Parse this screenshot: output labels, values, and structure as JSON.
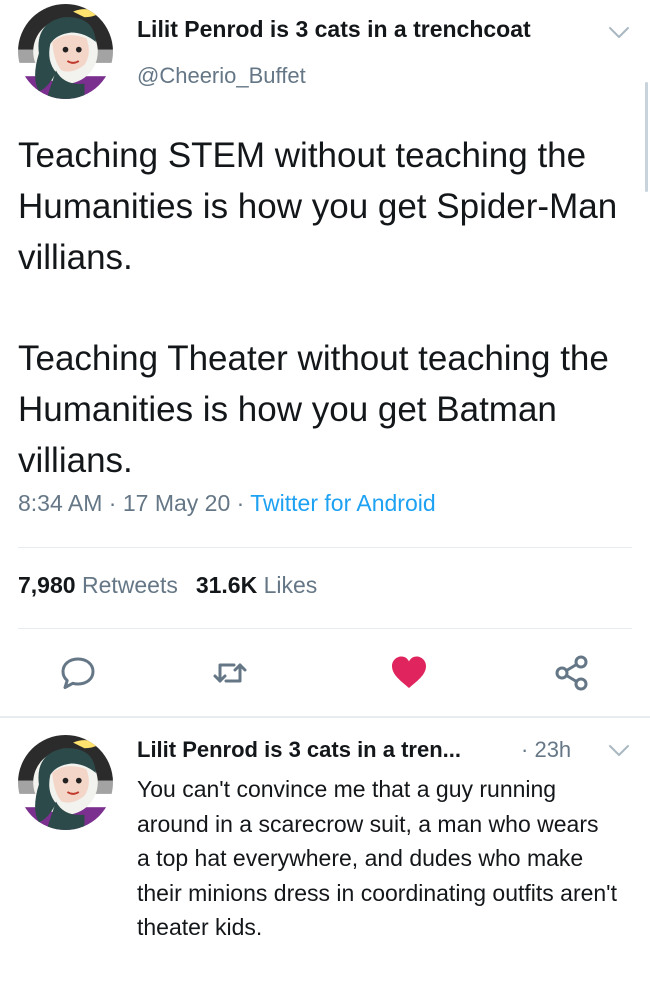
{
  "main_tweet": {
    "author_name": "Lilit Penrod is 3 cats in a trenchcoat",
    "handle": "@Cheerio_Buffet",
    "avatar_icon": "cartoon-avatar-icon",
    "paragraph1": "Teaching STEM without teaching the Humanities is how you get Spider-Man villians.",
    "paragraph2": "Teaching Theater without teaching the Humanities is how you get Batman villians.",
    "time": "8:34 AM",
    "date": "17 May 20",
    "source": "Twitter for Android",
    "retweets_count": "7,980",
    "retweets_label": "Retweets",
    "likes_count": "31.6K",
    "likes_label": "Likes",
    "liked": true
  },
  "actions": {
    "reply_icon": "comment-bubble-icon",
    "retweet_icon": "retweet-icon",
    "like_icon": "heart-icon",
    "share_icon": "share-icon"
  },
  "reply_tweet": {
    "author_name": "Lilit Penrod is 3 cats in a tren...",
    "time": "23h",
    "text": "You can't convince me that a guy running around in a scarecrow suit, a man who wears a top hat everywhere, and dudes who make their minions dress in coordinating outfits aren't theater kids."
  },
  "colors": {
    "text_primary": "#14171a",
    "text_secondary": "#657786",
    "link": "#1da1f2",
    "like": "#e0245e",
    "divider": "#e6ecf0",
    "avatar_flag_top": "#2b2b2b",
    "avatar_flag_purple": "#7b2f8e",
    "avatar_flag_grey": "#a3a3a3"
  }
}
